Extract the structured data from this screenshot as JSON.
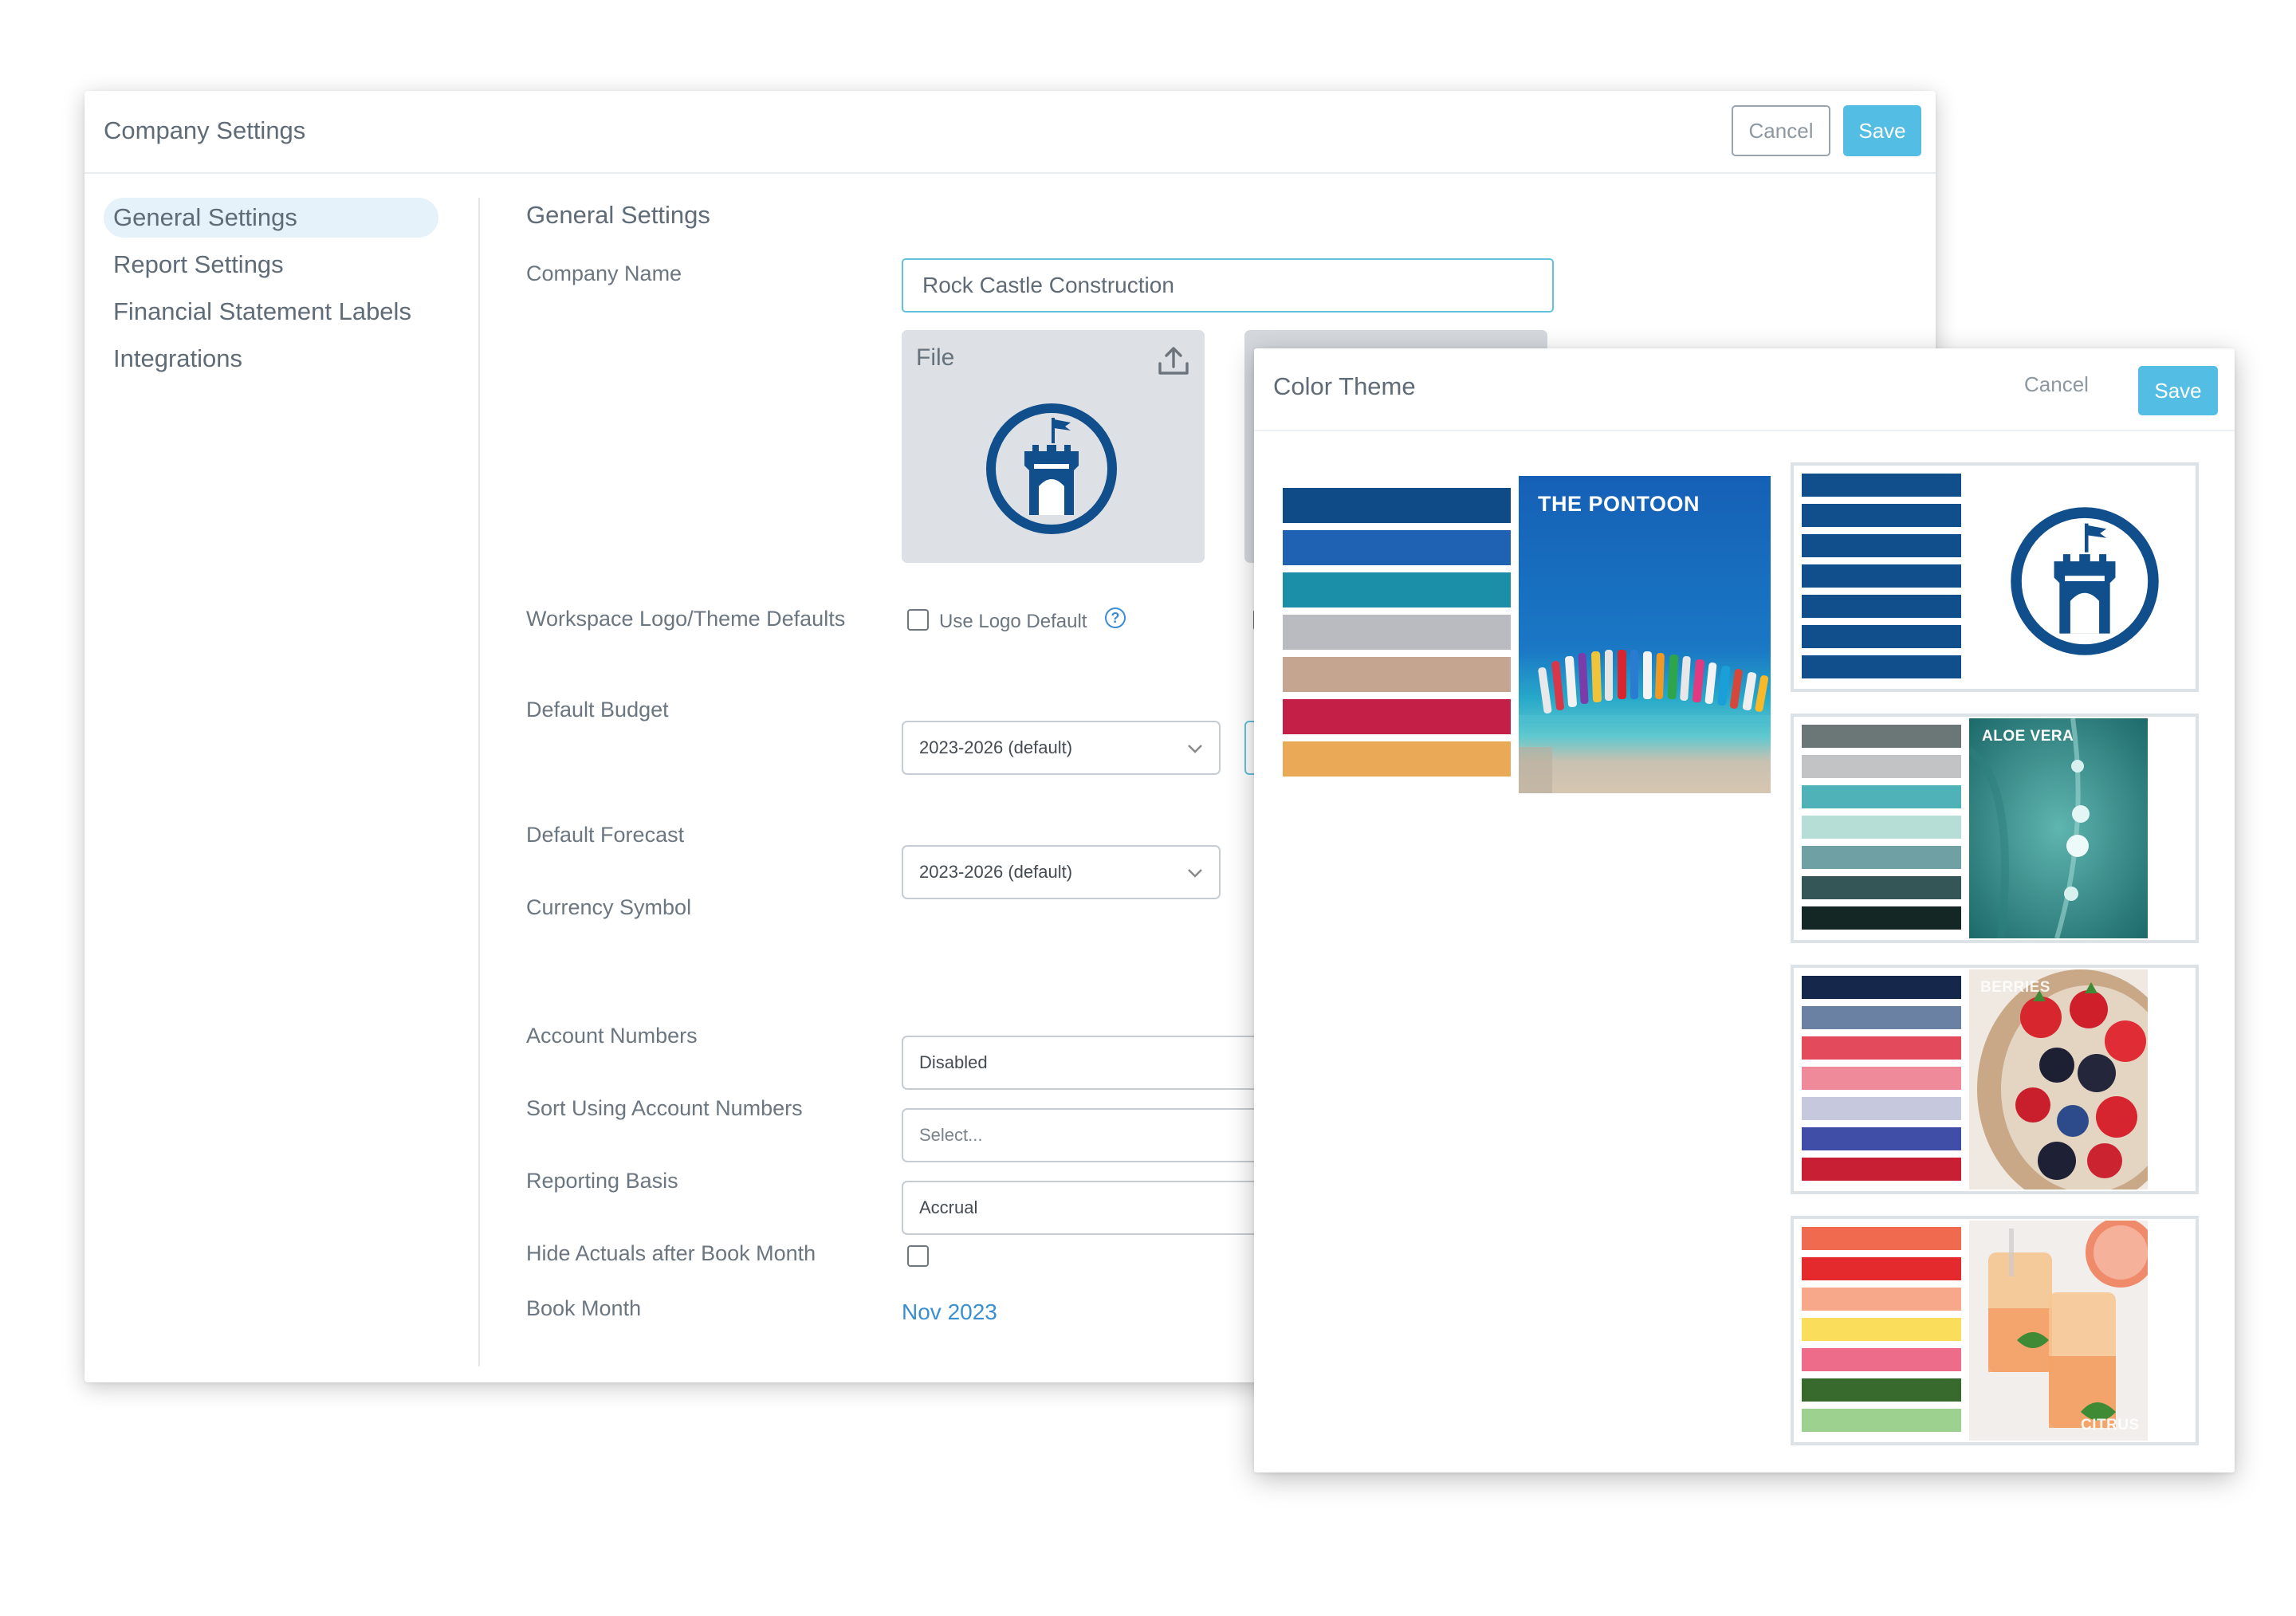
{
  "company_settings": {
    "title": "Company Settings",
    "cancel_label": "Cancel",
    "save_label": "Save",
    "nav": [
      {
        "label": "General Settings",
        "active": true
      },
      {
        "label": "Report Settings",
        "active": false
      },
      {
        "label": "Financial Statement Labels",
        "active": false
      },
      {
        "label": "Integrations",
        "active": false
      }
    ],
    "section_title": "General Settings",
    "labels": {
      "company_name": "Company Name",
      "workspace_logo": "Workspace Logo/Theme Defaults",
      "default_budget": "Default Budget",
      "default_forecast": "Default Forecast",
      "currency_symbol": "Currency Symbol",
      "account_numbers": "Account Numbers",
      "sort_account_numbers": "Sort Using Account Numbers",
      "reporting_basis": "Reporting Basis",
      "hide_actuals": "Hide Actuals after Book Month",
      "book_month": "Book Month"
    },
    "company_name_value": "Rock Castle Construction",
    "logo_file_label": "File",
    "use_logo_default_label": "Use Logo Default",
    "use_logo_default_checked": false,
    "default_budget_value": "2023-2026 (default)",
    "default_forecast_value": "2023-2026 (default)",
    "account_numbers_value": "Disabled",
    "sort_account_numbers_placeholder": "Select...",
    "reporting_basis_value": "Accrual",
    "hide_actuals_checked": false,
    "book_month_value": "Nov 2023"
  },
  "color_theme": {
    "title": "Color Theme",
    "cancel_label": "Cancel",
    "save_label": "Save",
    "selected_palette": [
      "#0f4c87",
      "#1f62b4",
      "#1b8fa8",
      "#b9bbc1",
      "#c5a490",
      "#c42047",
      "#e9a956"
    ],
    "selected_image_label": "THE PONTOON",
    "themes": [
      {
        "label": "",
        "stripes": [
          "#114e8c",
          "#114e8c",
          "#114e8c",
          "#114e8c",
          "#114e8c",
          "#114e8c",
          "#114e8c"
        ],
        "image": "castle-logo"
      },
      {
        "label": "ALOE VERA",
        "stripes": [
          "#6b7777",
          "#c1c3c5",
          "#4fb2b8",
          "#b7ded6",
          "#6fa1a4",
          "#345656",
          "#142724"
        ],
        "image": "aloe-photo"
      },
      {
        "label": "BERRIES",
        "stripes": [
          "#15284b",
          "#6b81a3",
          "#e34a5c",
          "#ee8a9a",
          "#c6c9dd",
          "#404ea8",
          "#c91f34"
        ],
        "image": "berries-photo"
      },
      {
        "label": "CITRUS",
        "stripes": [
          "#f06a4f",
          "#e42a2c",
          "#f7a88a",
          "#fbdd5c",
          "#ec6c89",
          "#376a2c",
          "#9dd18f"
        ],
        "image": "citrus-photo"
      }
    ]
  }
}
